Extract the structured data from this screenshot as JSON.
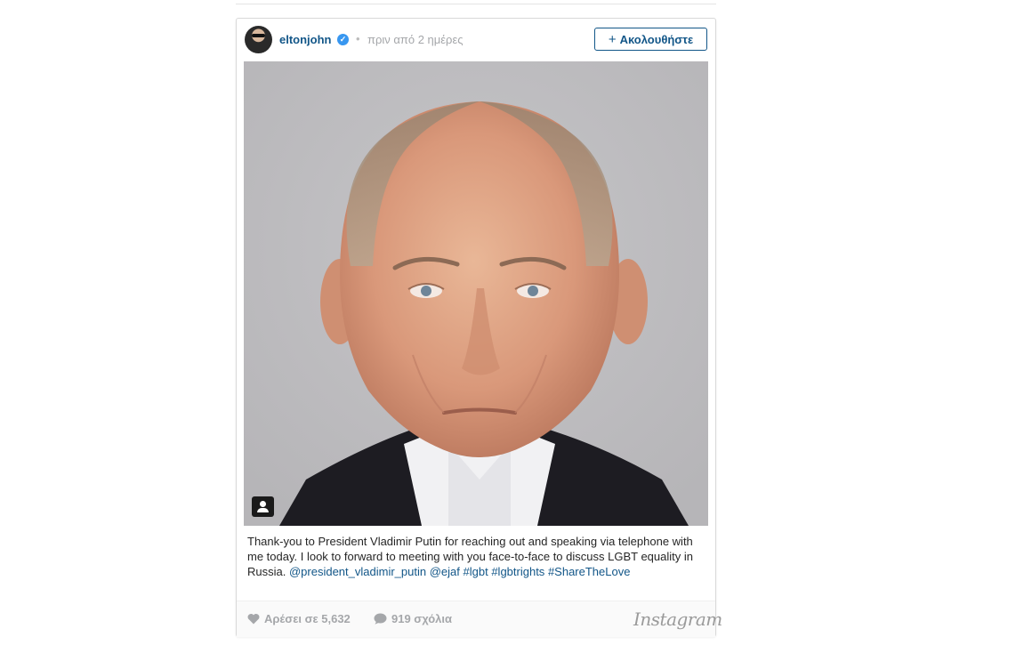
{
  "post": {
    "username": "eltonjohn",
    "separator": "•",
    "timestamp": "πριν από 2 ημέρες",
    "follow_label": "Ακολουθήστε",
    "follow_plus": "+",
    "caption": {
      "text": "Thank-you to President Vladimir Putin for reaching out and speaking via telephone with me today. I look to forward to meeting with you face-to-face to discuss LGBT equality in Russia. ",
      "mention_1": "@president_vladimir_putin",
      "mention_2": "@ejaf",
      "tag_1": "#lgbt",
      "tag_2": "#lgbtrights",
      "tag_3": "#ShareTheLove"
    },
    "likes_label": "Αρέσει σε 5,632",
    "comments_label": "919 σχόλια",
    "brand": "Instagram"
  },
  "colors": {
    "link": "#125688",
    "muted": "#a5a7aa",
    "verified": "#3897f0"
  },
  "icons": {
    "verified": "verified-badge-icon",
    "tag": "user-tag-icon",
    "like": "heart-icon",
    "comment": "speech-bubble-icon"
  }
}
